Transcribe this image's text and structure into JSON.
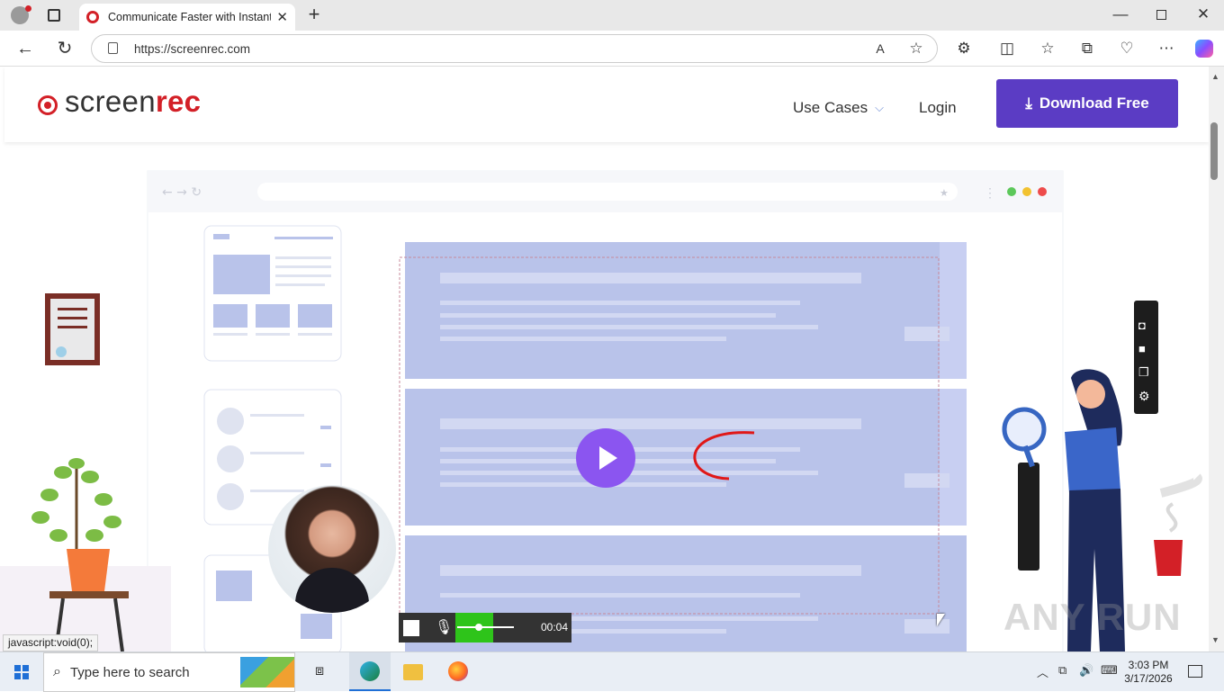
{
  "browser": {
    "tab_title": "Communicate Faster with Instant",
    "url": "https://screenrec.com",
    "status_text": "javascript:void(0);"
  },
  "site": {
    "logo_prefix": "screen",
    "logo_suffix": "rec",
    "nav_use_cases": "Use Cases",
    "nav_login": "Login",
    "download_button": "Download Free"
  },
  "recorder": {
    "timer": "00:04"
  },
  "taskbar": {
    "search_placeholder": "Type here to search",
    "time": "3:03 PM",
    "date": "3/17/2026"
  },
  "watermark": "ANY RUN",
  "colors": {
    "brand_red": "#d32027",
    "download_button": "#5b3cc4",
    "play_button": "#8b55f0",
    "content_blocks": "#b9c3ea",
    "recording_green": "#2ec41a"
  }
}
